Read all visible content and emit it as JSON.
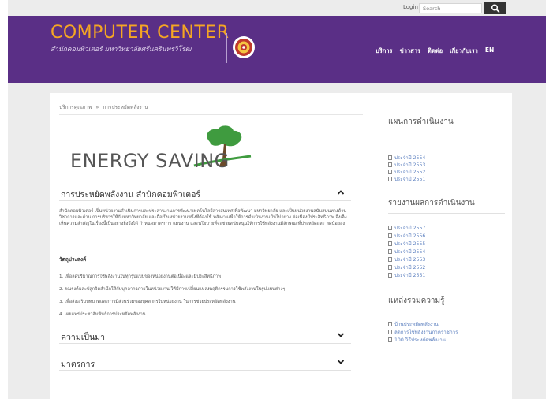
{
  "topbar": {
    "login_label": "Login",
    "search_placeholder": "Search"
  },
  "header": {
    "title": "COMPUTER CENTER",
    "subtitle": "สำนักคอมพิวเตอร์ มหาวิทยาลัยศรีนครินทรวิโรฒ",
    "nav": [
      "บริการ",
      "ข่าวสาร",
      "ติดต่อ",
      "เกี่ยวกับเรา",
      "EN"
    ]
  },
  "breadcrumb": {
    "home": "บริการคุณภาพ",
    "separator": "»",
    "current": "การประหยัดพลังงาน"
  },
  "banner": {
    "text": "ENERGY SAVING"
  },
  "sections": [
    {
      "title": "การประหยัดพลังงาน สำนักคอมพิวเตอร์",
      "expanded": true,
      "paragraph": "สำนักคอมพิวเตอร์ เป็นหน่วยงานดำเนินการและประสานงานการพัฒนาเทคโนโลยีสารสนเทศเพื่อพัฒนา มหาวิทยาลัย และเป็นหน่วยงานสนับสนุนทางด้านวิชาการและด้าน การบริหารให้กับมหาวิทยาลัย และถือเป็นหน่วยงานหนึ่งที่ต้องใช้ พลังงานเพื่อให้การดำเนินงานเป็นไปอย่าง ต่อเนื่องมีประสิทธิภาพ จึงเล็งเห็นความสำคัญในเรื่องนี้เป็นอย่างยิ่งจึงได้ กำหนดมาตรการ แผนงาน และนโยบายที่จะช่วยสนับสนุนให้การใช้พลังงานมีลักษณะที่ประหยัดและ ลดน้อยลง",
      "objectives_heading": "วัตถุประสงค์",
      "objectives": [
        "1.  เพื่อลดปริมาณการใช้พลังงานในทุกรูปแบบของหน่วยงานต่อเนื่องและมีประสิทธิภาพ",
        "2.  รณรงค์และปลูกจิตสำนึกให้กับบุคลากรภายในหน่วยงาน ให้มีการเปลี่ยนแปลงพฤติกรรมการใช้พลังงานในรูปแบบต่างๆ",
        "3.  เพื่อส่งเสริมบทบาทและการมีส่วนร่วมของบุคลากรในหน่วยงาน ในการช่วยประหยัดพลังงาน",
        "4.  เผยแพร่ประชาสัมพันธ์การประหยัดพลังงาน"
      ]
    },
    {
      "title": "ความเป็นมา",
      "expanded": false
    },
    {
      "title": "มาตรการ",
      "expanded": false
    }
  ],
  "sidebar": {
    "plans": {
      "heading": "แผนการดำเนินงาน",
      "items": [
        "ประจำปี 2554",
        "ประจำปี 2553",
        "ประจำปี 2552",
        "ประจำปี 2551"
      ]
    },
    "reports": {
      "heading": "รายงานผลการดำเนินงาน",
      "items": [
        "ประจำปี 2557",
        "ประจำปี 2556",
        "ประจำปี 2555",
        "ประจำปี 2554",
        "ประจำปี 2553",
        "ประจำปี 2552",
        "ประจำปี 2551"
      ]
    },
    "knowledge": {
      "heading": "แหล่งรวมความรู้",
      "items": [
        "บ้านประหยัดพลังงาน",
        "ลดการใช้พลังงานภาคราชการ",
        "100 วิธีประหยัดพลังงาน"
      ]
    }
  },
  "colors": {
    "header_bg": "#5a2f86",
    "title_orange": "#f5a623",
    "link_blue": "#5b7fbf",
    "leaf_green": "#3f9b3f"
  }
}
